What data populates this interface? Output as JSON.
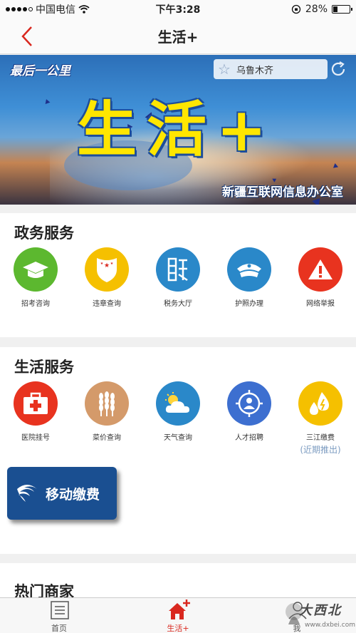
{
  "status_bar": {
    "carrier": "中国电信",
    "time": "下午3:28",
    "battery": "28%",
    "battery_level": 0.28
  },
  "nav": {
    "title": "生活+",
    "back_icon": "chevron-left-icon",
    "accent": "#d9281f"
  },
  "banner": {
    "slogan": "最后一公里",
    "main_title": "生活+",
    "org": "新疆互联网信息办公室",
    "city": "乌鲁木齐",
    "city_icon": "star-icon",
    "refresh_icon": "refresh-icon"
  },
  "gov_services": {
    "title": "政务服务",
    "items": [
      {
        "label": "招考咨询",
        "icon": "graduation-cap-icon",
        "color": "#5cb82f"
      },
      {
        "label": "违章查询",
        "icon": "police-badge-icon",
        "color": "#f5c000"
      },
      {
        "label": "税务大厅",
        "icon": "tax-icon",
        "color": "#2a88c9"
      },
      {
        "label": "护照办理",
        "icon": "officer-cap-icon",
        "color": "#2a88c9"
      },
      {
        "label": "网络举报",
        "icon": "warning-icon",
        "color": "#e8331f"
      }
    ]
  },
  "life_services": {
    "title": "生活服务",
    "items": [
      {
        "label": "医院挂号",
        "icon": "medical-kit-icon",
        "color": "#e8331f"
      },
      {
        "label": "菜价查询",
        "icon": "wheat-icon",
        "color": "#d49a6a"
      },
      {
        "label": "天气查询",
        "icon": "weather-icon",
        "color": "#2a88c9"
      },
      {
        "label": "人才招聘",
        "icon": "person-target-icon",
        "color": "#3d6fd0"
      },
      {
        "label": "三江缴费",
        "icon": "utilities-icon",
        "color": "#f5c000",
        "note": "(近期推出)"
      }
    ],
    "mobile_pay": {
      "label": "移动缴费",
      "icon": "china-mobile-icon",
      "color": "#1a4f91"
    }
  },
  "hot_merchants": {
    "title": "热门商家"
  },
  "tab_bar": {
    "tabs": [
      {
        "label": "首页",
        "icon": "document-icon"
      },
      {
        "label": "生活+",
        "icon": "home-plus-icon",
        "active": true
      },
      {
        "label": "我",
        "icon": "user-icon"
      }
    ]
  },
  "watermark": {
    "text": "大西北",
    "url": "www.dxbei.com"
  }
}
